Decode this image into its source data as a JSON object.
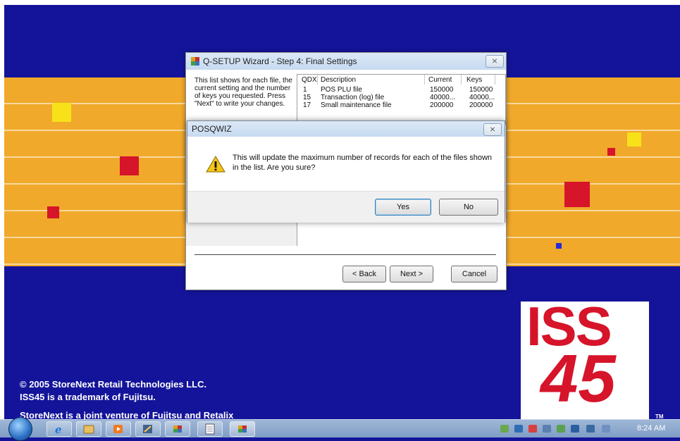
{
  "desktop": {
    "copyright_line1": "© 2005 StoreNext Retail Technologies LLC.",
    "copyright_line2": "ISS45 is a trademark of Fujitsu.",
    "copyright_line3": "StoreNext is a joint venture of Fujitsu and Retalix",
    "logo_top": "ISS",
    "logo_bottom": "45",
    "logo_tm": "TM",
    "colors": {
      "background": "#14149a",
      "band": "#f0a92a",
      "logo": "#d6142a"
    }
  },
  "wizard": {
    "title": "Q-SETUP Wizard - Step 4: Final Settings",
    "close_label": "⨯",
    "description": "This list shows for each file, the current setting and the number of keys you requested. Press \"Next\" to write your changes.",
    "columns": [
      "QDX",
      "Description",
      "Current",
      "Keys"
    ],
    "rows": [
      {
        "qdx": "1",
        "description": "POS PLU file",
        "current": "150000",
        "keys": "150000"
      },
      {
        "qdx": "15",
        "description": "Transaction (log) file",
        "current": "40000...",
        "keys": "40000..."
      },
      {
        "qdx": "17",
        "description": "Small maintenance file",
        "current": "200000",
        "keys": "200000"
      }
    ],
    "back_label": "< Back",
    "next_label": "Next >",
    "cancel_label": "Cancel"
  },
  "dialog": {
    "title": "POSQWIZ",
    "close_label": "⨯",
    "icon": "warning-icon",
    "message": "This will update the maximum number of records for each of the files shown in the list. Are you sure?",
    "yes_label": "Yes",
    "no_label": "No"
  },
  "taskbar": {
    "clock": "8:24 AM",
    "apps": [
      "internet-explorer-icon",
      "windows-explorer-icon",
      "media-player-icon",
      "paint-icon",
      "setup-icon",
      "notepad-icon",
      "wizard-icon"
    ]
  }
}
